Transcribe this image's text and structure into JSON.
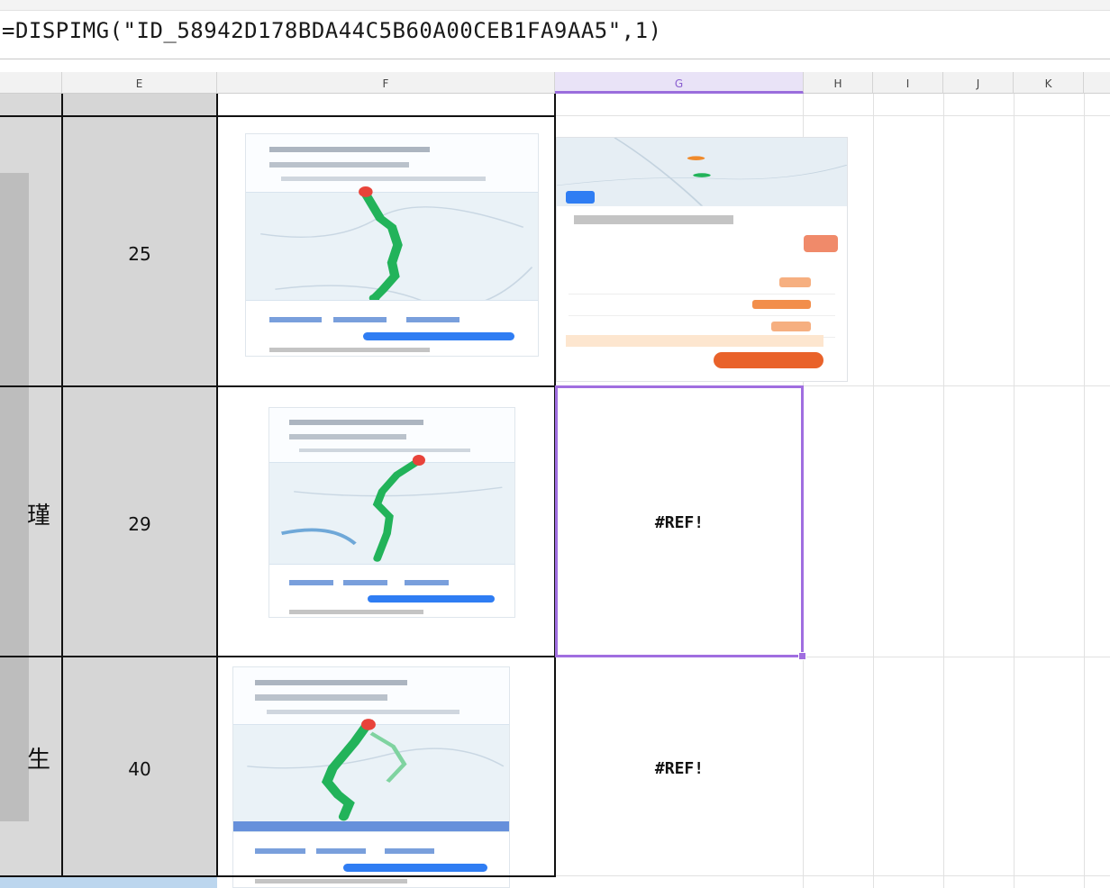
{
  "formula_bar": {
    "text": "=DISPIMG(\"ID_58942D178BDA44C5B60A00CEB1FA9AA5\",1)"
  },
  "columns": [
    "E",
    "F",
    "G",
    "H",
    "I",
    "J",
    "K"
  ],
  "selected_column": "G",
  "rows": [
    {
      "e_value": "25",
      "d_text": "",
      "g_content": "image"
    },
    {
      "e_value": "29",
      "d_text": "瑾",
      "g_content": "#REF!"
    },
    {
      "e_value": "40",
      "d_text": "生",
      "g_content": "#REF!"
    }
  ],
  "colors": {
    "selection": "#a06ee0",
    "column_e_fill": "#d6d6d6",
    "route_green": "#22b35a",
    "button_blue": "#2f7df3"
  }
}
